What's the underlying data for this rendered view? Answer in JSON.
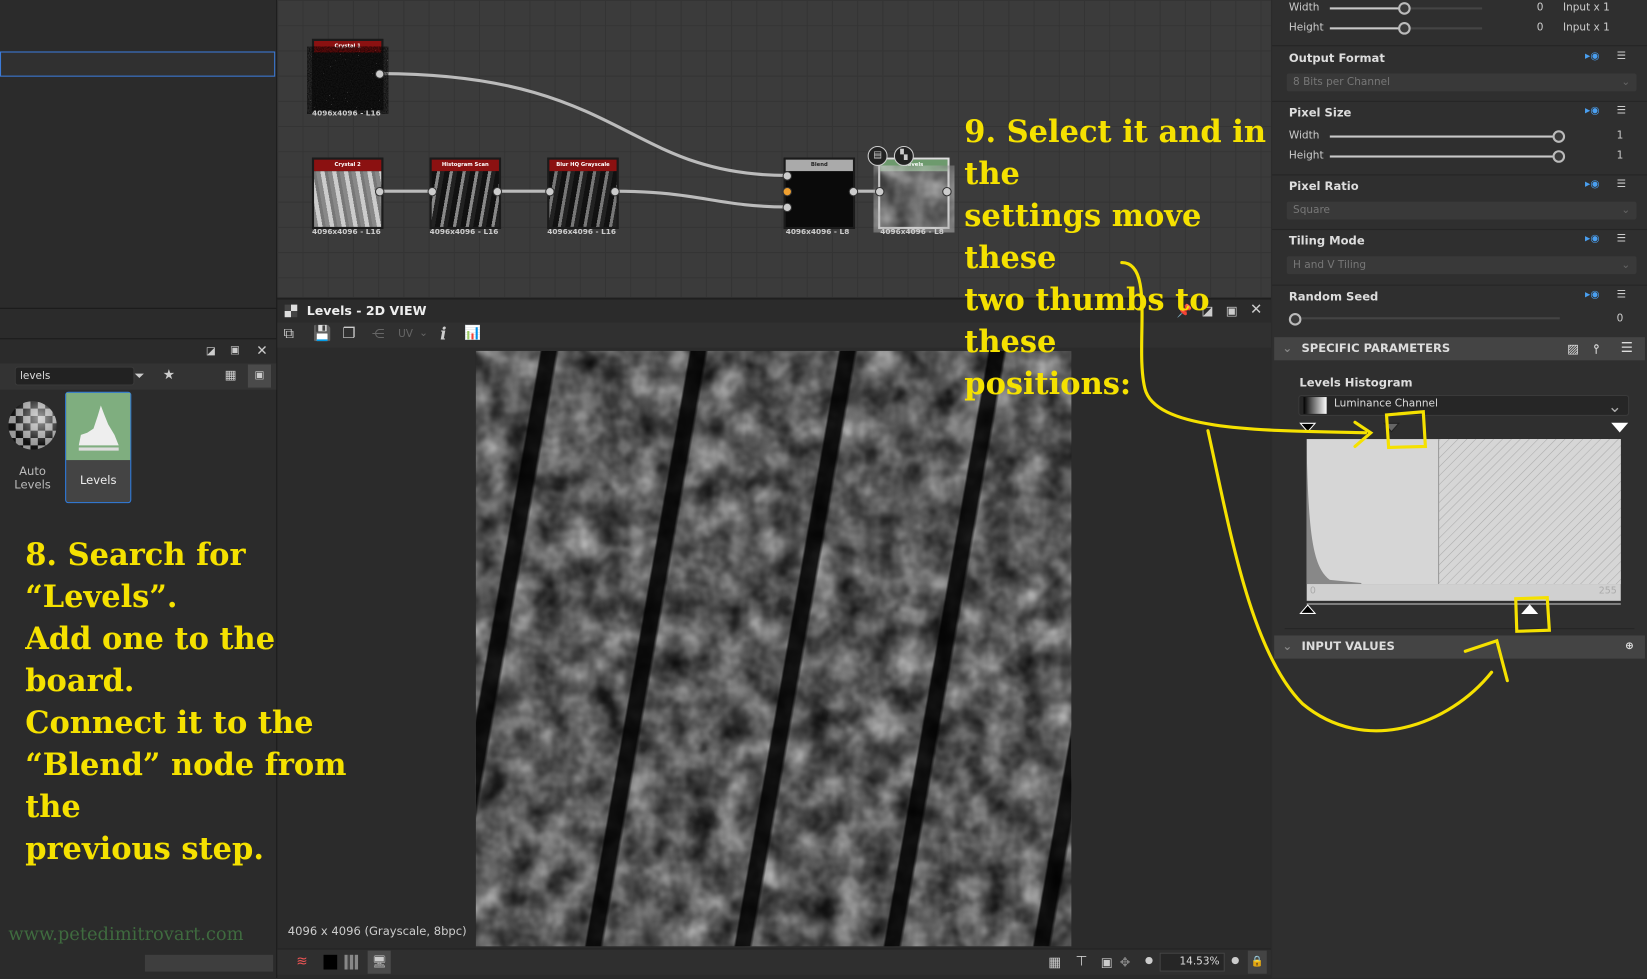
{
  "graph": {
    "nodes": [
      {
        "title": "Crystal 1",
        "res": "4096x4096 - L16"
      },
      {
        "title": "Crystal 2",
        "res": "4096x4096 - L16"
      },
      {
        "title": "Histogram Scan",
        "res": "4096x4096 - L16"
      },
      {
        "title": "Blur HQ Grayscale",
        "res": "4096x4096 - L16"
      },
      {
        "title": "Blend",
        "res": "4096x4096 - L8"
      },
      {
        "title": "Levels",
        "res": "4096x4096 - L8"
      }
    ]
  },
  "library": {
    "search_value": "levels",
    "items": [
      {
        "label": "Auto Levels"
      },
      {
        "label": "Levels"
      }
    ]
  },
  "view2d": {
    "title": "Levels - 2D VIEW",
    "uv_label": "UV",
    "status": "4096 x 4096 (Grayscale, 8bpc)",
    "zoom": "14.53%"
  },
  "annotations": {
    "step8": [
      "8. Search for “Levels”.",
      "Add one to the board.",
      "Connect it to the",
      "“Blend” node from the",
      "previous step."
    ],
    "step9": [
      "9. Select it and in the",
      "settings move these",
      "two thumbs to these",
      "positions:"
    ],
    "watermark": "www.petedimitrovart.com",
    "color": "#f5e100"
  },
  "params": {
    "output_size": {
      "width_label": "Width",
      "width_value": "0",
      "width_unit": "Input x 1",
      "height_label": "Height",
      "height_value": "0",
      "height_unit": "Input x 1"
    },
    "output_format": {
      "label": "Output Format",
      "value": "8 Bits per Channel"
    },
    "pixel_size": {
      "label": "Pixel Size",
      "width_label": "Width",
      "width_value": "1",
      "height_label": "Height",
      "height_value": "1"
    },
    "pixel_ratio": {
      "label": "Pixel Ratio",
      "value": "Square"
    },
    "tiling_mode": {
      "label": "Tiling Mode",
      "value": "H and V Tiling"
    },
    "random_seed": {
      "label": "Random Seed",
      "value": "0"
    },
    "specific": {
      "label": "SPECIFIC PARAMETERS"
    },
    "levels_histogram": {
      "label": "Levels Histogram",
      "channel": "Luminance Channel",
      "axis_min": "0",
      "axis_max": "255",
      "level_in_mid": 0.3,
      "level_out_high": 0.71
    },
    "input_values": {
      "label": "INPUT VALUES"
    }
  }
}
